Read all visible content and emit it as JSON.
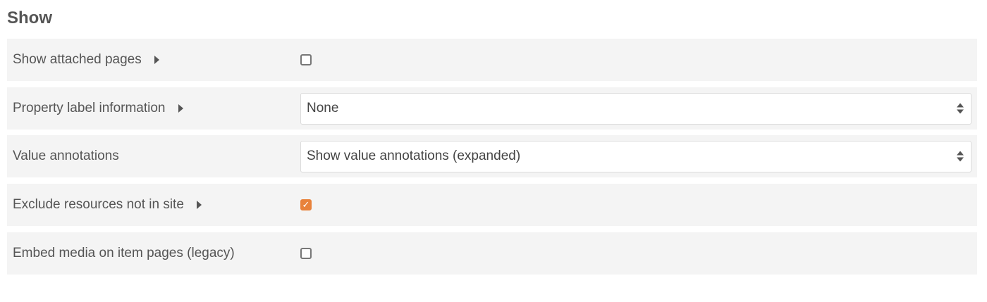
{
  "section": {
    "title": "Show"
  },
  "rows": [
    {
      "label": "Show attached pages",
      "has_caret": true,
      "control": "checkbox",
      "checked": false
    },
    {
      "label": "Property label information",
      "has_caret": true,
      "control": "select",
      "selected": "None"
    },
    {
      "label": "Value annotations",
      "has_caret": false,
      "control": "select",
      "selected": "Show value annotations (expanded)"
    },
    {
      "label": "Exclude resources not in site",
      "has_caret": true,
      "control": "checkbox",
      "checked": true
    },
    {
      "label": "Embed media on item pages (legacy)",
      "has_caret": false,
      "control": "checkbox",
      "checked": false
    }
  ],
  "colors": {
    "row_background": "#f4f4f4",
    "checkbox_checked": "#e8823b",
    "text": "#555555"
  },
  "icons": {
    "caret": "caret-right-icon",
    "select": "select-arrows-icon",
    "check": "checkmark-icon"
  }
}
